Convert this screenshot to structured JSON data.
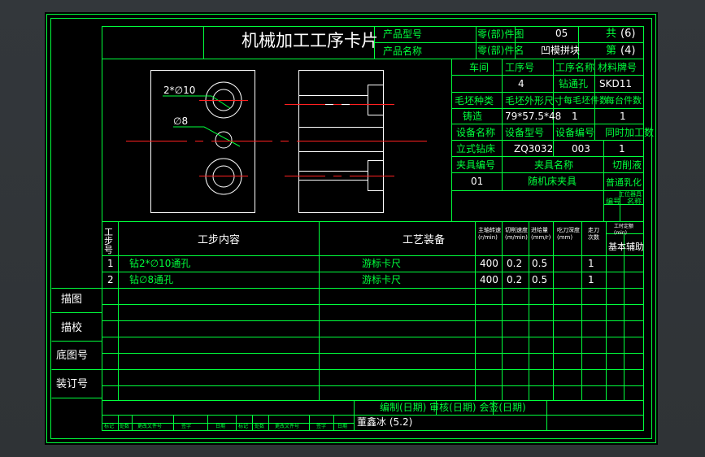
{
  "card": {
    "title": "机械加工工序卡片",
    "product_model_label": "产品型号",
    "product_name_label": "产品名称",
    "part_no_label": "零(部)件图",
    "part_no_value": "05",
    "part_name_label": "零(部)件名",
    "part_name_value": "凹模拼块",
    "total_label": "共",
    "total_value": "(6)",
    "page_label": "第",
    "page_value": "(4)"
  },
  "info": {
    "workshop_label": "车间",
    "op_no_label": "工序号",
    "op_name_label": "工序名称",
    "material_label": "材料牌号",
    "op_no": "4",
    "op_name": "钻通孔",
    "material": "SKD11",
    "blank_type_label": "毛坯种类",
    "blank_size_label": "毛坯外形尺寸",
    "pieces_per_blank_label": "每毛坯件数",
    "pieces_per_unit_label": "每台件数",
    "blank_type": "铸造",
    "blank_size": "79*57.5*48",
    "pieces_per_blank": "1",
    "pieces_per_unit": "1",
    "equip_name_label": "设备名称",
    "equip_model_label": "设备型号",
    "equip_no_label": "设备编号",
    "simul_label": "同时加工数",
    "equip_name": "立式钻床",
    "equip_model": "ZQ3032",
    "equip_no": "003",
    "simul": "1",
    "fixture_no_label": "夹具编号",
    "fixture_name_label": "夹具名称",
    "coolant_label": "切削液",
    "fixture_no": "01",
    "fixture_name": "随机床夹具",
    "coolant": "普通乳化",
    "fixture_small": "工位器具",
    "fixture_small2": "编号",
    "fixture_small3": "名称"
  },
  "drawing": {
    "dim1": "2*∅10",
    "dim2": "∅8"
  },
  "table": {
    "col_step": "工步号",
    "col_content": "工步内容",
    "col_equip": "工艺装备",
    "col_spindle": "主轴转速 (r/min)",
    "col_speed": "切削速度 (m/min)",
    "col_feed": "进给量 (mm/r)",
    "col_depth": "吃刀深度 (mm)",
    "col_passes": "走刀次数",
    "col_time": "工时定额 (min)",
    "col_basic": "基本",
    "col_aux": "辅助",
    "rows": [
      {
        "step": "1",
        "content": "钻2*∅10通孔",
        "equip": "游标卡尺",
        "spindle": "400",
        "speed": "0.2",
        "feed": "0.5",
        "passes": "1"
      },
      {
        "step": "2",
        "content": "钻∅8通孔",
        "equip": "游标卡尺",
        "spindle": "400",
        "speed": "0.2",
        "feed": "0.5",
        "passes": "1"
      }
    ]
  },
  "side": {
    "draw": "描图",
    "check": "描校",
    "base_no": "底图号",
    "bind_no": "装订号"
  },
  "footer": {
    "sign": "编制(日期)  审核(日期)  会签(日期)",
    "author": "董鑫冰  (5.2)",
    "marks": [
      "标记",
      "处数",
      "更改文件号",
      "签字",
      "日期",
      "标记",
      "处数",
      "更改文件号",
      "签字",
      "日期"
    ]
  }
}
